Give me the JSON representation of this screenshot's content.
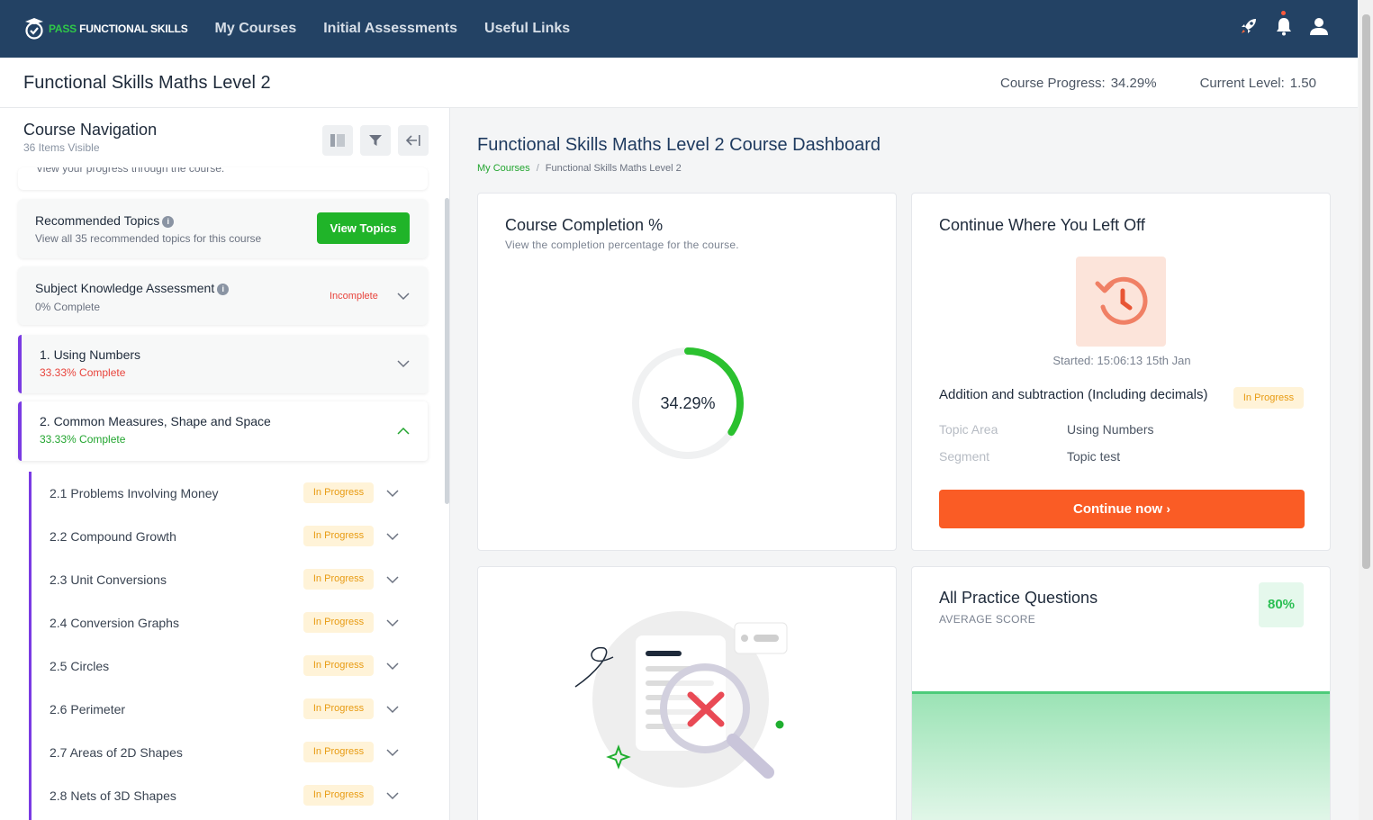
{
  "nav": {
    "logo_pass": "PASS",
    "logo_rest": "FUNCTIONAL SKILLS",
    "links": [
      "My Courses",
      "Initial Assessments",
      "Useful Links"
    ],
    "icons": [
      "rocket-icon",
      "bell-icon",
      "user-icon"
    ]
  },
  "subheader": {
    "course_title": "Functional Skills Maths Level 2",
    "progress_label": "Course Progress:",
    "progress_value": "34.29%",
    "level_label": "Current Level:",
    "level_value": "1.50"
  },
  "sidebar": {
    "title": "Course Navigation",
    "subtitle": "36 Items Visible",
    "clipped_text": "View your progress through the course.",
    "recommended": {
      "title": "Recommended Topics",
      "subtitle": "View all 35 recommended topics for this course",
      "button": "View Topics"
    },
    "assessment": {
      "title": "Subject Knowledge Assessment",
      "subtitle": "0% Complete",
      "status": "Incomplete"
    },
    "topics": [
      {
        "title": "1. Using Numbers",
        "progress": "33.33% Complete"
      },
      {
        "title": "2. Common Measures, Shape and Space",
        "progress": "33.33% Complete"
      }
    ],
    "subtopics": [
      {
        "label": "2.1 Problems Involving Money",
        "status": "In Progress"
      },
      {
        "label": "2.2 Compound Growth",
        "status": "In Progress"
      },
      {
        "label": "2.3 Unit Conversions",
        "status": "In Progress"
      },
      {
        "label": "2.4 Conversion Graphs",
        "status": "In Progress"
      },
      {
        "label": "2.5 Circles",
        "status": "In Progress"
      },
      {
        "label": "2.6 Perimeter",
        "status": "In Progress"
      },
      {
        "label": "2.7 Areas of 2D Shapes",
        "status": "In Progress"
      },
      {
        "label": "2.8 Nets of 3D Shapes",
        "status": "In Progress"
      }
    ]
  },
  "main": {
    "title": "Functional Skills Maths Level 2 Course Dashboard",
    "breadcrumb": {
      "home": "My Courses",
      "current": "Functional Skills Maths Level 2"
    },
    "completion": {
      "title": "Course Completion %",
      "subtitle": "View the completion percentage for the course.",
      "value_label": "34.29%",
      "fraction": 0.3429
    },
    "continue": {
      "title": "Continue Where You Left Off",
      "started": "Started: 15:06:13 15th Jan",
      "lesson": "Addition and subtraction (Including decimals)",
      "status": "In Progress",
      "topic_area_label": "Topic Area",
      "topic_area_value": "Using Numbers",
      "segment_label": "Segment",
      "segment_value": "Topic test",
      "button": "Continue now"
    },
    "practice": {
      "title": "All Practice Questions",
      "subtitle": "AVERAGE SCORE",
      "score": "80%"
    }
  },
  "colors": {
    "nav_bg": "#234264",
    "accent_green": "#20b429",
    "accent_orange": "#fa5c25",
    "topic_purple": "#7a3be3",
    "in_progress": "#e89b12",
    "incomplete": "#e8443c"
  }
}
